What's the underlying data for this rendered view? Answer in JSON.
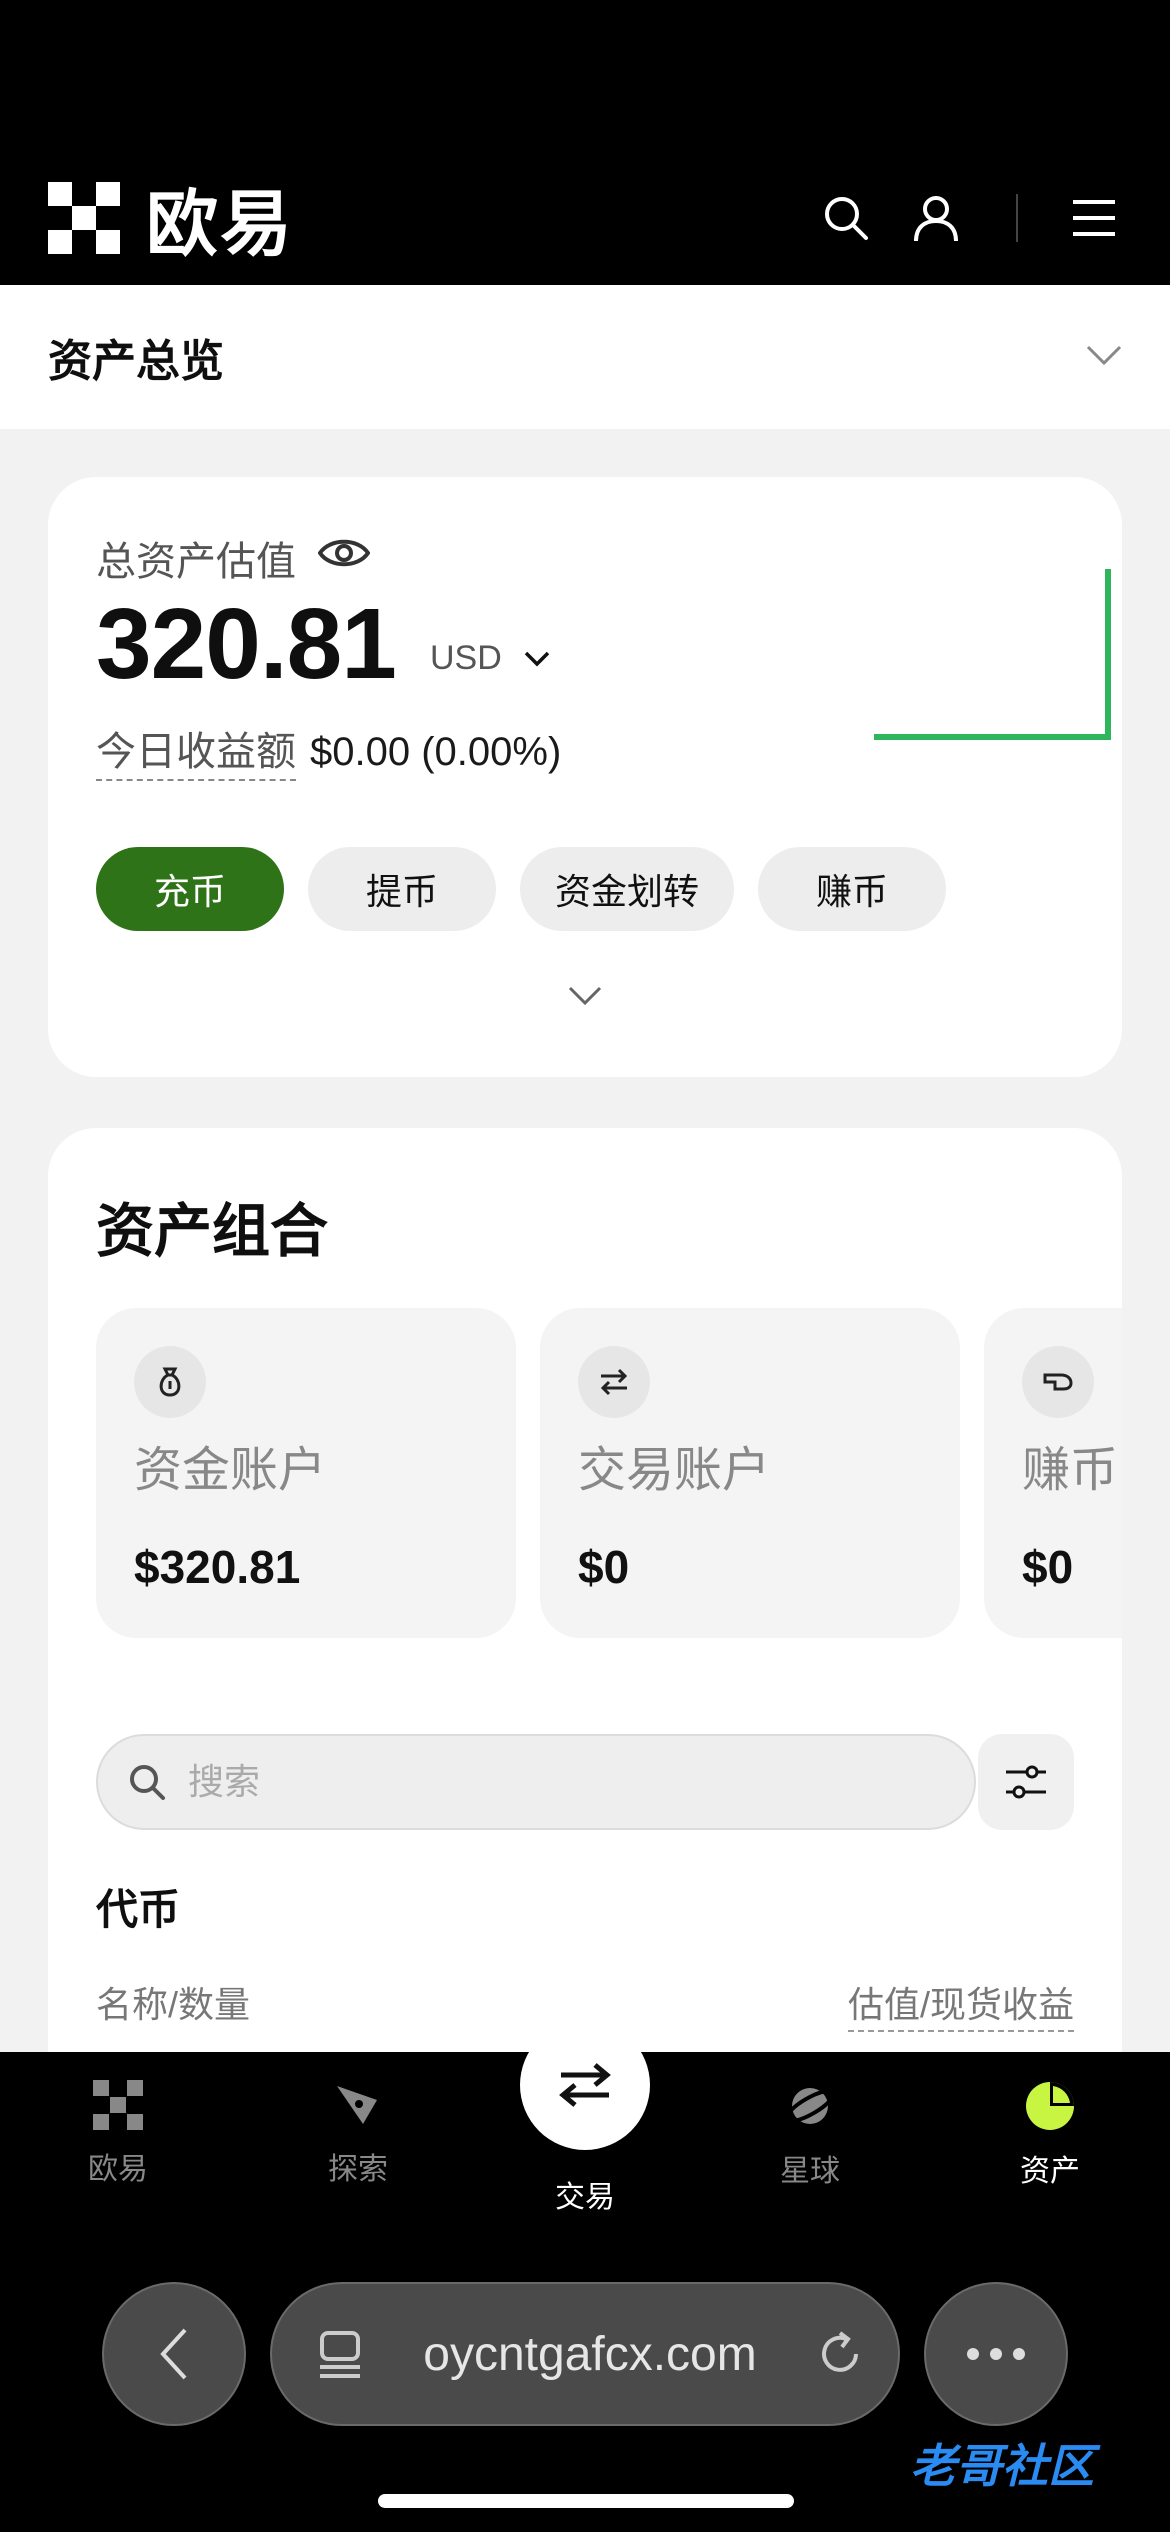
{
  "header": {
    "brand": "欧易"
  },
  "section": {
    "title": "资产总览"
  },
  "overview": {
    "estimate_label": "总资产估值",
    "total": "320.81",
    "currency": "USD",
    "today_label": "今日收益额",
    "today_value": "$0.00 (0.00%)",
    "sparkline_color": "#2fb55c",
    "actions": [
      "充币",
      "提币",
      "资金划转",
      "赚币"
    ]
  },
  "portfolio": {
    "title": "资产组合",
    "accounts": [
      {
        "name": "资金账户",
        "value": "$320.81",
        "icon": "moneybag-icon"
      },
      {
        "name": "交易账户",
        "value": "$0",
        "icon": "swap-icon"
      },
      {
        "name": "赚币",
        "value": "$0",
        "icon": "earn-icon"
      }
    ],
    "search_placeholder": "搜索",
    "coins_title": "代币",
    "col_left": "名称/数量",
    "col_right": "估值/现货收益"
  },
  "tabbar": {
    "tabs": [
      "欧易",
      "探索",
      "交易",
      "星球",
      "资产"
    ],
    "active": "资产",
    "accent": "#c8f542"
  },
  "browser": {
    "url": "oycntgafcx.com"
  },
  "watermark": "老哥社区",
  "colors": {
    "primary_green": "#2e7317",
    "background": "#f2f2f2"
  }
}
